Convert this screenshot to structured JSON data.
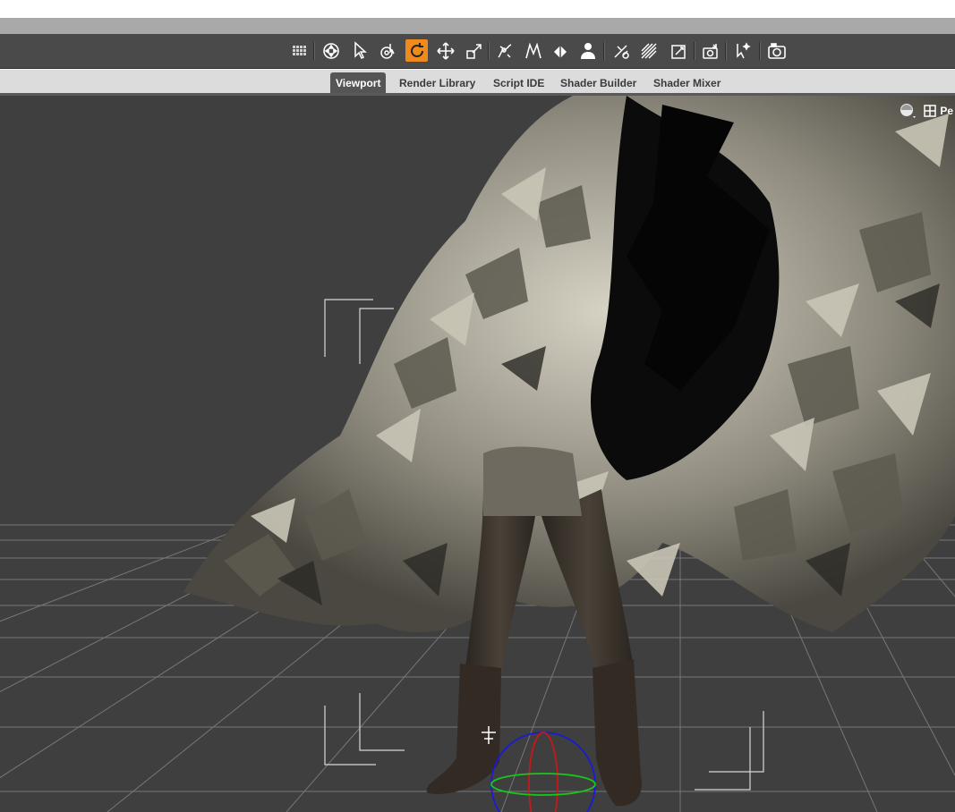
{
  "tabs": [
    {
      "label": "Viewport",
      "active": true
    },
    {
      "label": "Render Library",
      "active": false
    },
    {
      "label": "Script IDE",
      "active": false
    },
    {
      "label": "Shader Builder",
      "active": false
    },
    {
      "label": "Shader Mixer",
      "active": false
    }
  ],
  "toolbar": {
    "tools": [
      "pixel-grid-icon",
      "universal-manipulator-icon",
      "node-selection-icon",
      "surface-selection-icon",
      "rotate-tool-icon",
      "translate-tool-icon",
      "scale-tool-icon",
      "joint-editor-icon",
      "geometry-editor-icon",
      "surface-tool-icon",
      "figure-tool-icon",
      "spot-render-icon",
      "region-navigator-icon",
      "transfer-tool-icon",
      "camera-tool-icon",
      "magic-pointer-icon",
      "render-camera-icon"
    ],
    "active_tool": "rotate-tool-icon"
  },
  "viewport": {
    "view_label": "Pe",
    "view_label_note": "truncated at window edge"
  },
  "colors": {
    "toolbar_bg": "#4a4a4a",
    "active_tool": "#f08a1c",
    "viewport_bg": "#3f3f3f",
    "tab_bar_bg": "#dcdcdc",
    "active_tab_bg": "#555555"
  }
}
